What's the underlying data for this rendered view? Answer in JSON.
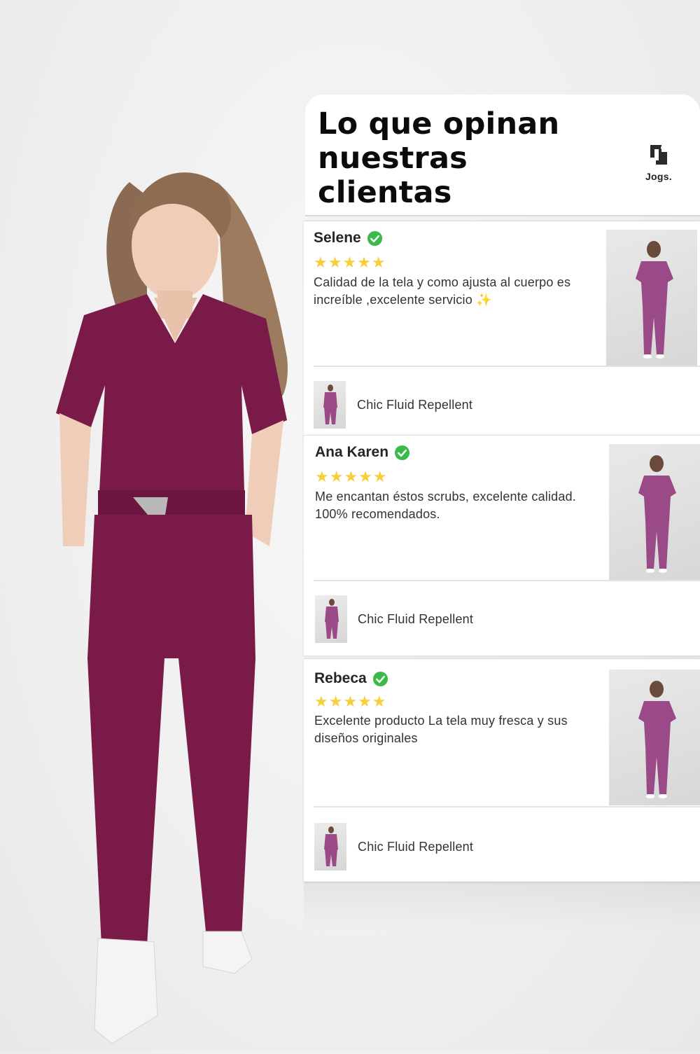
{
  "header": {
    "title": "Lo que opinan nuestras clientas",
    "brand": "Jogs."
  },
  "colors": {
    "scrubs": "#7a1a48",
    "scrubs_photo": "#9a4a86",
    "stars": "#f7cf3c",
    "verified": "#3bba4a"
  },
  "reviews": [
    {
      "name": "Selene",
      "rating": 5,
      "stars": "★★★★★",
      "text": "Calidad de la tela y como ajusta al cuerpo es increíble ,excelente servicio ✨",
      "product": "Chic Fluid Repellent"
    },
    {
      "name": "Ana Karen",
      "rating": 5,
      "stars": "★★★★★",
      "text": "Me encantan éstos scrubs, excelente calidad. 100% recomendados.",
      "product": "Chic Fluid Repellent"
    },
    {
      "name": "Rebeca",
      "rating": 5,
      "stars": "★★★★★",
      "text": "Excelente producto La tela muy fresca y sus diseños originales",
      "product": "Chic Fluid Repellent"
    }
  ]
}
